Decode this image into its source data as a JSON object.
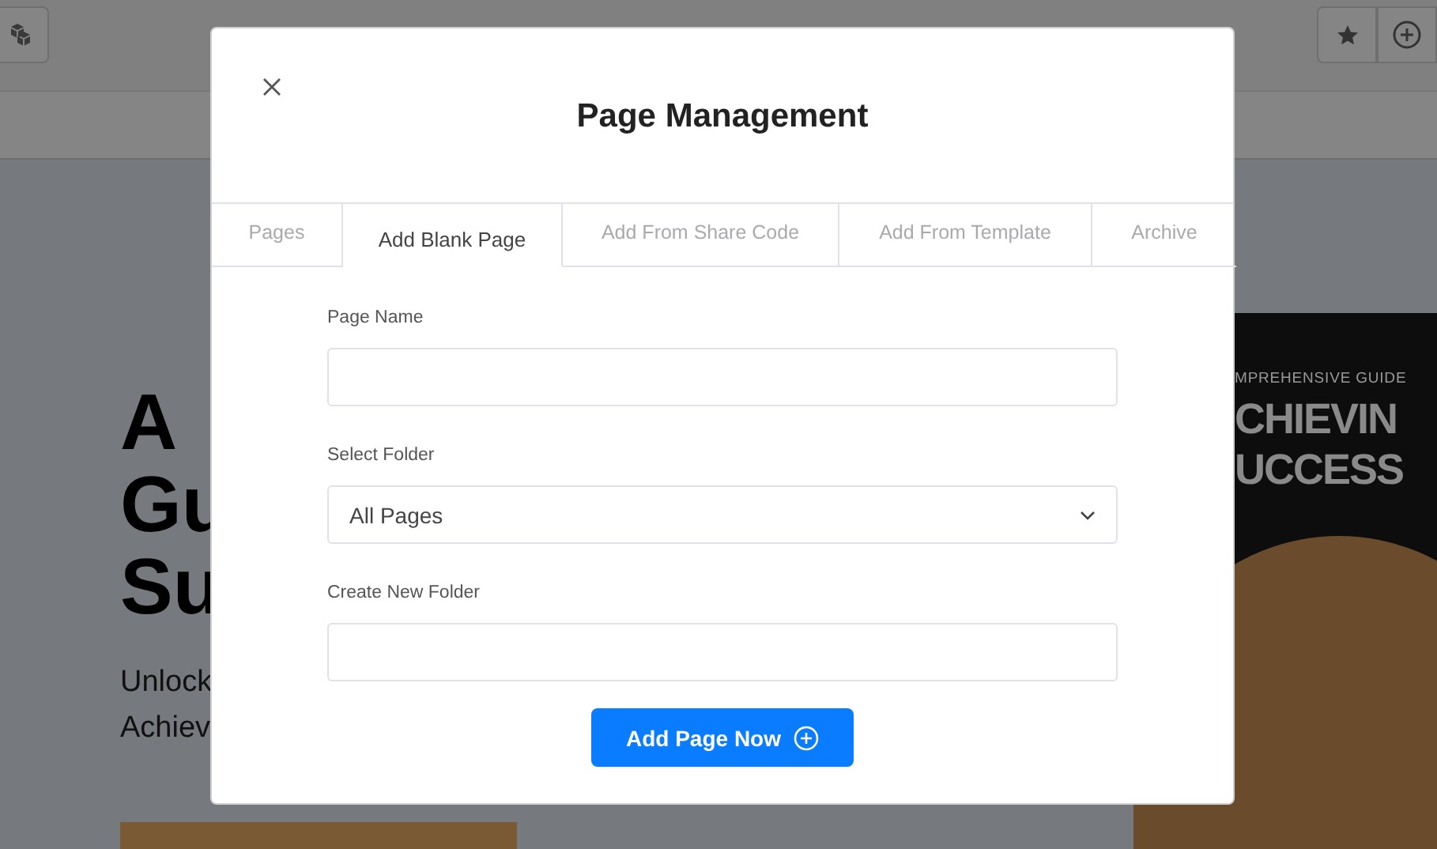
{
  "background_page": {
    "headline_lines": [
      "A",
      "Gu",
      "Su"
    ],
    "subtitle_lines": [
      "Unlock",
      "Achiev"
    ],
    "book_cover": {
      "kicker": "MPREHENSIVE GUIDE",
      "title_lines": [
        "CHIEVIN",
        "UCCESS"
      ]
    }
  },
  "modal": {
    "title": "Page Management",
    "tabs": [
      {
        "label": "Pages",
        "selected": false
      },
      {
        "label": "Add Blank Page",
        "selected": true
      },
      {
        "label": "Add From Share Code",
        "selected": false
      },
      {
        "label": "Add From Template",
        "selected": false
      },
      {
        "label": "Archive",
        "selected": false
      }
    ],
    "fields": [
      {
        "kind": "text",
        "label": "Page Name"
      },
      {
        "kind": "select",
        "label": "Select Folder",
        "value": "All Pages"
      },
      {
        "kind": "text",
        "label": "Create New Folder"
      }
    ],
    "submit": "Add Page Now"
  }
}
